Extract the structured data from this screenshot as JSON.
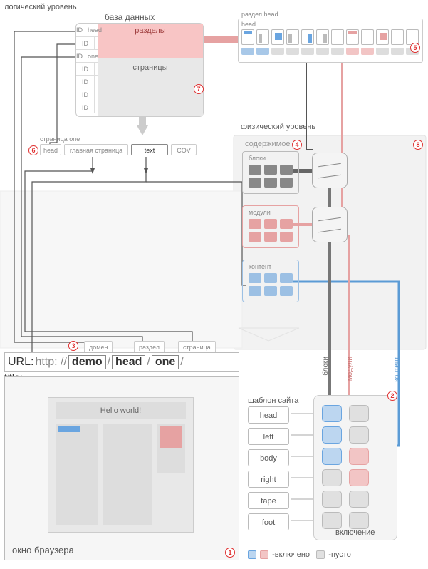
{
  "labels": {
    "logical_level": "логический уровень",
    "physical_level": "физический уровень",
    "database": "база данных",
    "sections": "разделы",
    "pages": "страницы",
    "section_head": "раздел head",
    "head_small": "head",
    "page_one": "страница one",
    "content_group": "содержимое",
    "blocks": "блоки",
    "modules": "модули",
    "content": "контент",
    "site_template": "шаблон сайта",
    "inclusion": "включение",
    "browser_window": "окно браузера",
    "url_prefix": "URL:",
    "url_proto": "http: //",
    "domain_word": "домен",
    "section_word": "раздел",
    "page_word": "страница",
    "title_word": "title:",
    "legend_on": "-включено",
    "legend_empty": "-пусто"
  },
  "db": {
    "rows": [
      "head",
      "",
      "one",
      "",
      "",
      "",
      ""
    ]
  },
  "page_one_cells": {
    "head": "head",
    "main": "главная страница",
    "text": "text",
    "cov": "COV"
  },
  "url": {
    "domain": "demo",
    "section": "head",
    "page": "one"
  },
  "title_value": "главная страница",
  "hello": "Hello world!",
  "template_areas": [
    "head",
    "left",
    "body",
    "right",
    "tape",
    "foot"
  ],
  "vlabels": {
    "blocks": "блоки",
    "modules": "модули",
    "content": "контент"
  },
  "badges": {
    "b1": "1",
    "b2": "2",
    "b3": "3",
    "b4": "4",
    "b5": "5",
    "b6": "6",
    "b7": "7",
    "b8": "8"
  },
  "ID": "ID"
}
